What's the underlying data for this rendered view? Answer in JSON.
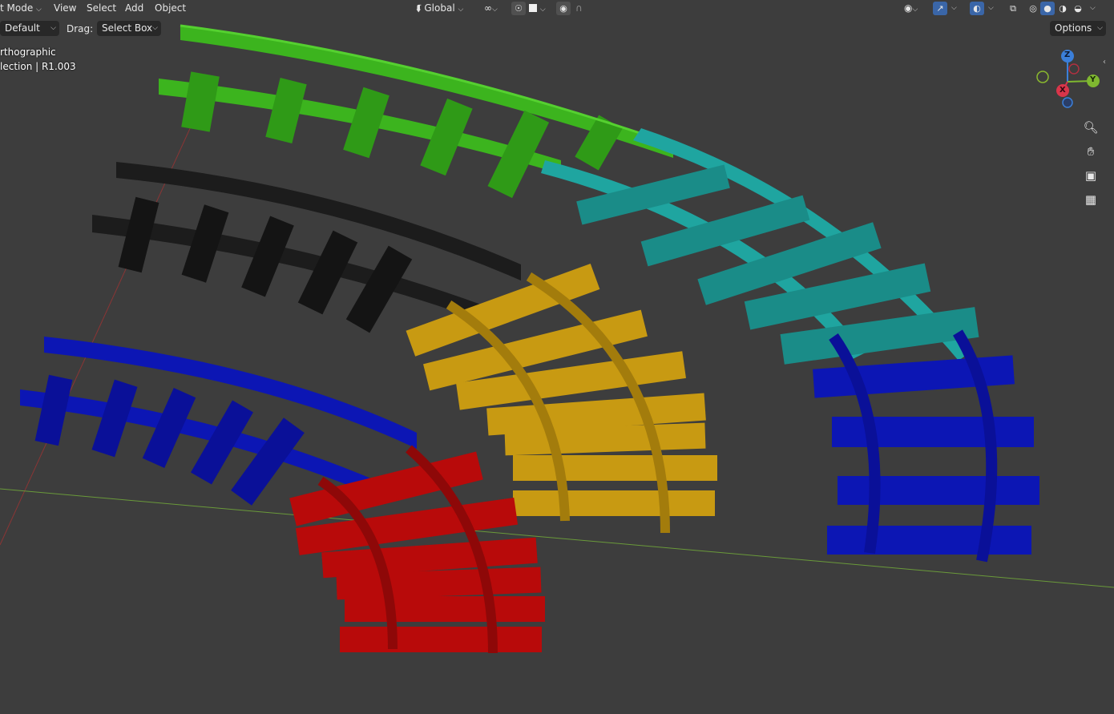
{
  "header": {
    "mode_label": "t Mode",
    "menus": [
      "View",
      "Select",
      "Add",
      "Object"
    ],
    "orientation_label": "Global"
  },
  "toolbar": {
    "orientation_preset": "Default",
    "drag_label": "Drag:",
    "drag_value": "Select Box",
    "options_label": "Options"
  },
  "viewport_info": {
    "view_name": "rthographic",
    "collection": "lection | R1.003"
  },
  "gizmo": {
    "x_label": "X",
    "y_label": "Y",
    "z_label": "Z"
  },
  "colors": {
    "background": "#3d3d3d",
    "grid_x_axis": "#7a3a3a",
    "grid_y_axis": "#6a9a3a",
    "green_track": "#3cb41e",
    "teal_track": "#1fa5a0",
    "black_track": "#1c1c1c",
    "yellow_track": "#c89a12",
    "blue_track": "#0c16b4",
    "red_track": "#b80a0a"
  },
  "icons": {
    "zoom": "zoom-in-icon",
    "pan": "hand-icon",
    "camera": "camera-icon",
    "grid": "grid-icon"
  }
}
